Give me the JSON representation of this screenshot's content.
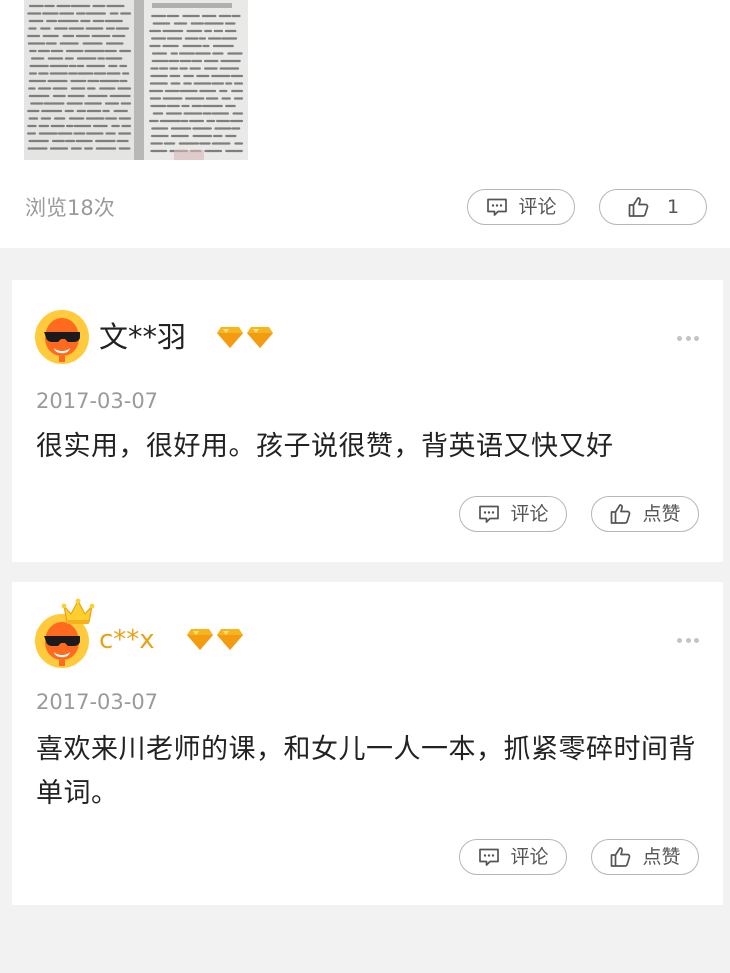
{
  "post": {
    "view_count": "浏览18次",
    "comment_label": "评论",
    "like_count": "1"
  },
  "comments": [
    {
      "username": "文**羽",
      "username_color": "#222222",
      "has_crown": false,
      "avatar": "orange-mascot-avatar",
      "badges": [
        "gold-diamond-icon",
        "gold-diamond-icon"
      ],
      "date": "2017-03-07",
      "text": "很实用，很好用。孩子说很赞，背英语又快又好",
      "comment_label": "评论",
      "like_label": "点赞"
    },
    {
      "username": "c**x",
      "username_color": "#e8a21a",
      "has_crown": true,
      "avatar": "orange-mascot-avatar",
      "badges": [
        "gold-diamond-icon",
        "gold-diamond-icon"
      ],
      "date": "2017-03-07",
      "text": "喜欢来川老师的课，和女儿一人一本，抓紧零碎时间背单词。",
      "comment_label": "评论",
      "like_label": "点赞"
    }
  ],
  "colors": {
    "background": "#f2f2f2",
    "card": "#ffffff",
    "muted_text": "#9a9a9a",
    "body_text": "#222222",
    "pill_border": "#b6b6b6",
    "vip_username": "#e8a21a",
    "diamond": "#f6b51c"
  }
}
